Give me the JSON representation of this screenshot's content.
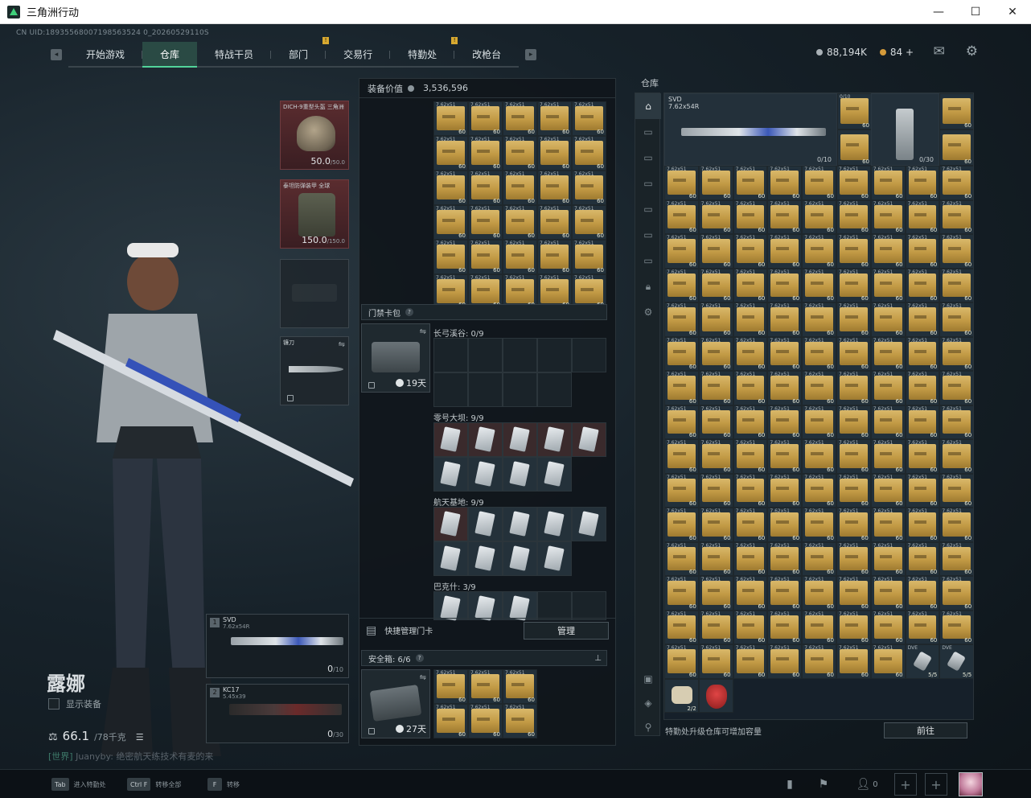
{
  "window": {
    "title": "三角洲行动",
    "controls": [
      "—",
      "☐",
      "✕"
    ]
  },
  "uid": "CN UID:18935568007198563524 0_20260529110S",
  "nav": {
    "tabs": [
      {
        "label": "开始游戏",
        "badge": false
      },
      {
        "label": "仓库",
        "badge": false,
        "active": true
      },
      {
        "label": "特战干员",
        "badge": false
      },
      {
        "label": "部门",
        "badge": true
      },
      {
        "label": "交易行",
        "badge": false
      },
      {
        "label": "特勤处",
        "badge": true
      },
      {
        "label": "改枪台",
        "badge": false
      }
    ],
    "currency_silver": "88,194K",
    "currency_gold": "84",
    "currency_plus": "+"
  },
  "character": {
    "name": "露娜",
    "show_equip_label": "显示装备",
    "weight_value": "66.1",
    "weight_max": "/78千克",
    "chat_tag": "[世界]",
    "chat_text": "Juanyby: 绝密航天练技术有麦的来"
  },
  "gear": {
    "helmet_label": "DICH-9重型头盔 三角洲",
    "helmet_dur": "50.0",
    "helmet_max": "/50.0",
    "vest_label": "泰坦防弹装甲 全球",
    "vest_dur": "150.0",
    "vest_max": "/150.0",
    "melee_label": "镰刀"
  },
  "weapons": [
    {
      "index": "1",
      "name": "SVD",
      "caliber": "7.62x54R",
      "cap": "0",
      "cap_max": "/10"
    },
    {
      "index": "2",
      "name": "KC17",
      "caliber": "5.45x39",
      "cap": "0",
      "cap_max": "/30"
    }
  ],
  "middle": {
    "equip_value_label": "装备价值",
    "equip_value": "3,536,596",
    "ammo_count": "60",
    "ammo_caliber": "7.62x51",
    "keycard_section": "门禁卡包",
    "keycase_time": "19天",
    "maps": [
      {
        "label": "长弓溪谷: 0/9"
      },
      {
        "label": "零号大坝: 9/9"
      },
      {
        "label": "航天基地: 9/9"
      },
      {
        "label": "巴克什: 3/9"
      }
    ],
    "quick_manage_label": "快捷管理门卡",
    "manage_button": "管理",
    "safebox_label": "安全箱: 6/6",
    "safebox_time": "27天"
  },
  "warehouse": {
    "title": "仓库",
    "svd_name": "SVD",
    "svd_caliber": "7.62x54R",
    "svd_cap": "0/10",
    "stock_cap": "0/30",
    "top_cap": "0/10",
    "ammo_count": "60",
    "ammo_caliber": "7.62x51",
    "dve_label": "DVE",
    "dve_count": "5/5",
    "misc_count": "2/2",
    "footer_text": "特勤处升级仓库可增加容量",
    "goto_button": "前往"
  },
  "bottom": {
    "hints": [
      {
        "key": "Tab",
        "label": "进入特勤处"
      },
      {
        "key": "Ctrl F",
        "label": "转移全部"
      },
      {
        "key": "F",
        "label": "转移"
      }
    ],
    "friends_count": "0"
  },
  "colors": {
    "accent": "#52d39a",
    "active_tab_bg": "#2a4a44",
    "ammo": "#c29a45",
    "badge": "#d8a930"
  }
}
